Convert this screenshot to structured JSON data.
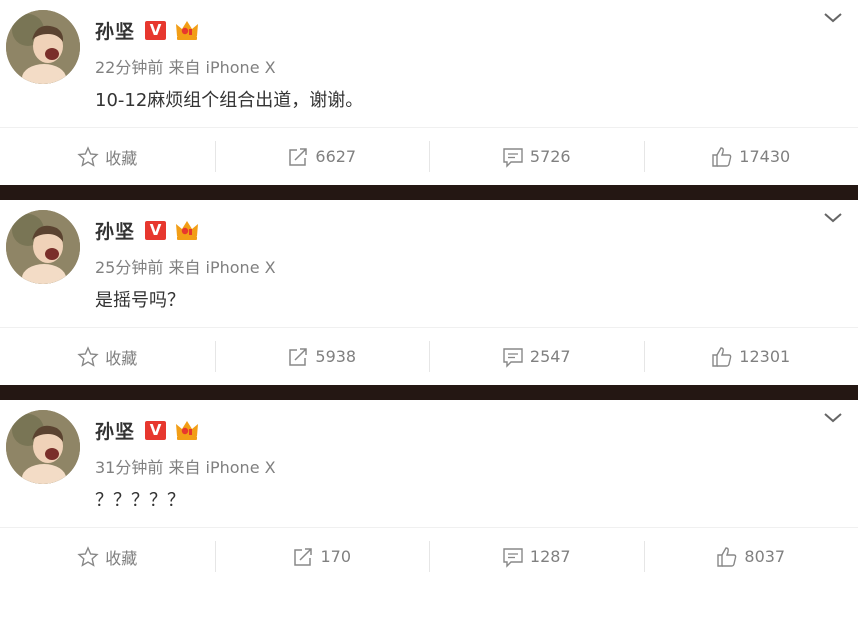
{
  "posts": [
    {
      "author": "孙坚",
      "verified_badge": "V",
      "meta": "22分钟前 来自 iPhone X",
      "text": "10-12麻烦组个组合出道，谢谢。",
      "favorite_label": "收藏",
      "reposts": "6627",
      "comments": "5726",
      "likes": "17430"
    },
    {
      "author": "孙坚",
      "verified_badge": "V",
      "meta": "25分钟前 来自 iPhone X",
      "text": "是摇号吗？",
      "favorite_label": "收藏",
      "reposts": "5938",
      "comments": "2547",
      "likes": "12301"
    },
    {
      "author": "孙坚",
      "verified_badge": "V",
      "meta": "31分钟前 来自 iPhone X",
      "text": "？？？？？",
      "favorite_label": "收藏",
      "reposts": "170",
      "comments": "1287",
      "likes": "8037"
    }
  ],
  "icons": {
    "favorite": "star-outline-icon",
    "repost": "share-arrow-icon",
    "comment": "speech-bubble-icon",
    "like": "thumbs-up-icon",
    "menu": "chevron-down-icon",
    "member": "crown-badge-icon"
  },
  "colors": {
    "verified": "#e7372e",
    "crown": "#f29e16",
    "divider": "#241713",
    "meta_text": "#808080"
  }
}
